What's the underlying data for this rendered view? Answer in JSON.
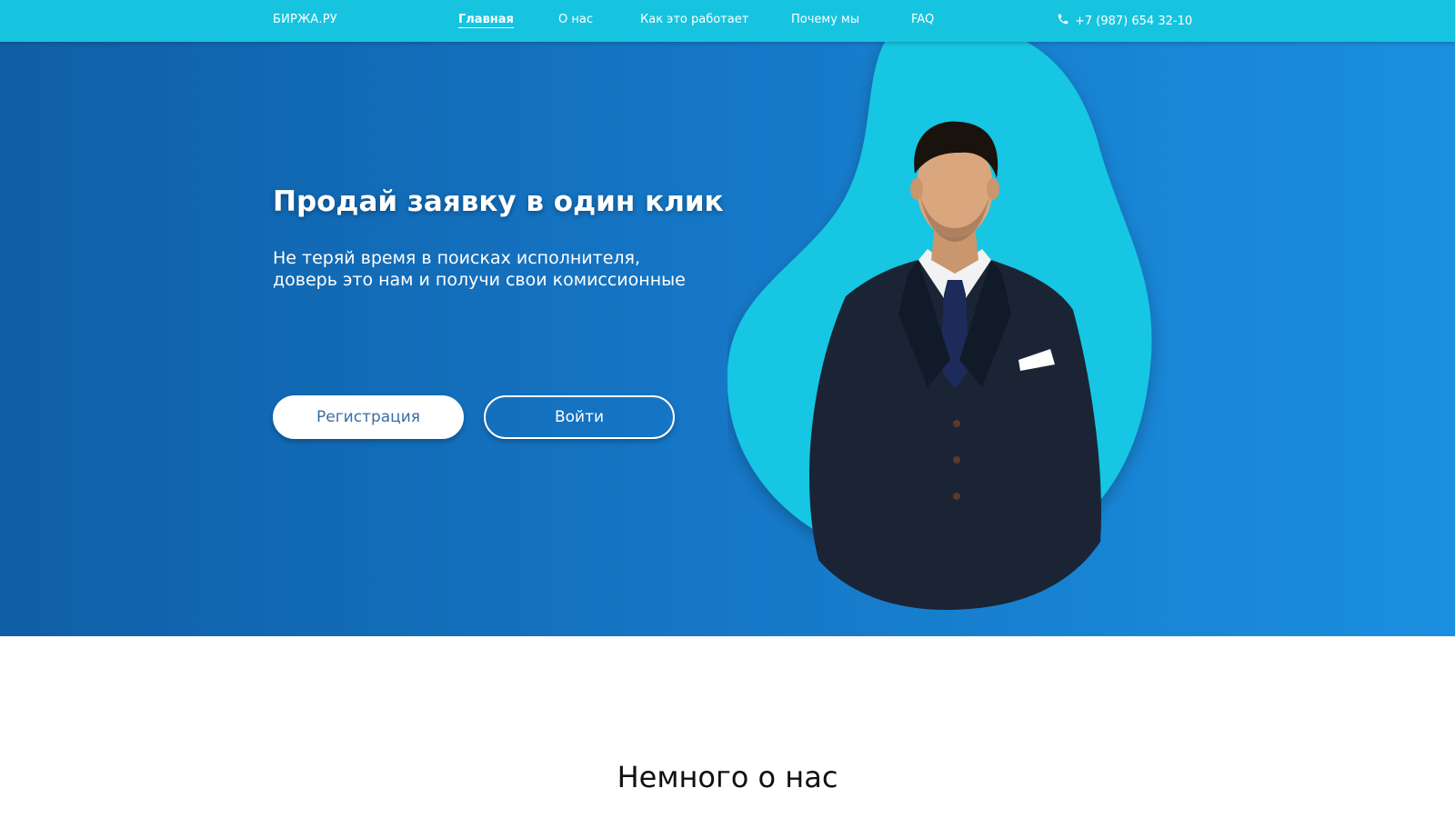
{
  "header": {
    "logo": "БИРЖА.РУ",
    "nav": [
      {
        "label": "Главная",
        "active": true
      },
      {
        "label": "О нас",
        "active": false
      },
      {
        "label": "Как это работает",
        "active": false
      },
      {
        "label": "Почему мы",
        "active": false
      },
      {
        "label": "FAQ",
        "active": false
      }
    ],
    "phone": "+7 (987) 654 32-10",
    "phone_icon": "phone-icon"
  },
  "hero": {
    "title": "Продай заявку в один клик",
    "subtitle_line1": "Не теряй время в поисках исполнителя,",
    "subtitle_line2": "доверь это нам и получи свои комиссионные",
    "register_label": "Регистрация",
    "login_label": "Войти"
  },
  "about": {
    "title": "Немного о нас"
  },
  "colors": {
    "nav_bg": "#16c4e0",
    "hero_gradient_start": "#0f5fa6",
    "hero_gradient_end": "#1b8fe0",
    "blob": "#17c6e2",
    "register_text": "#3a6ea6"
  }
}
